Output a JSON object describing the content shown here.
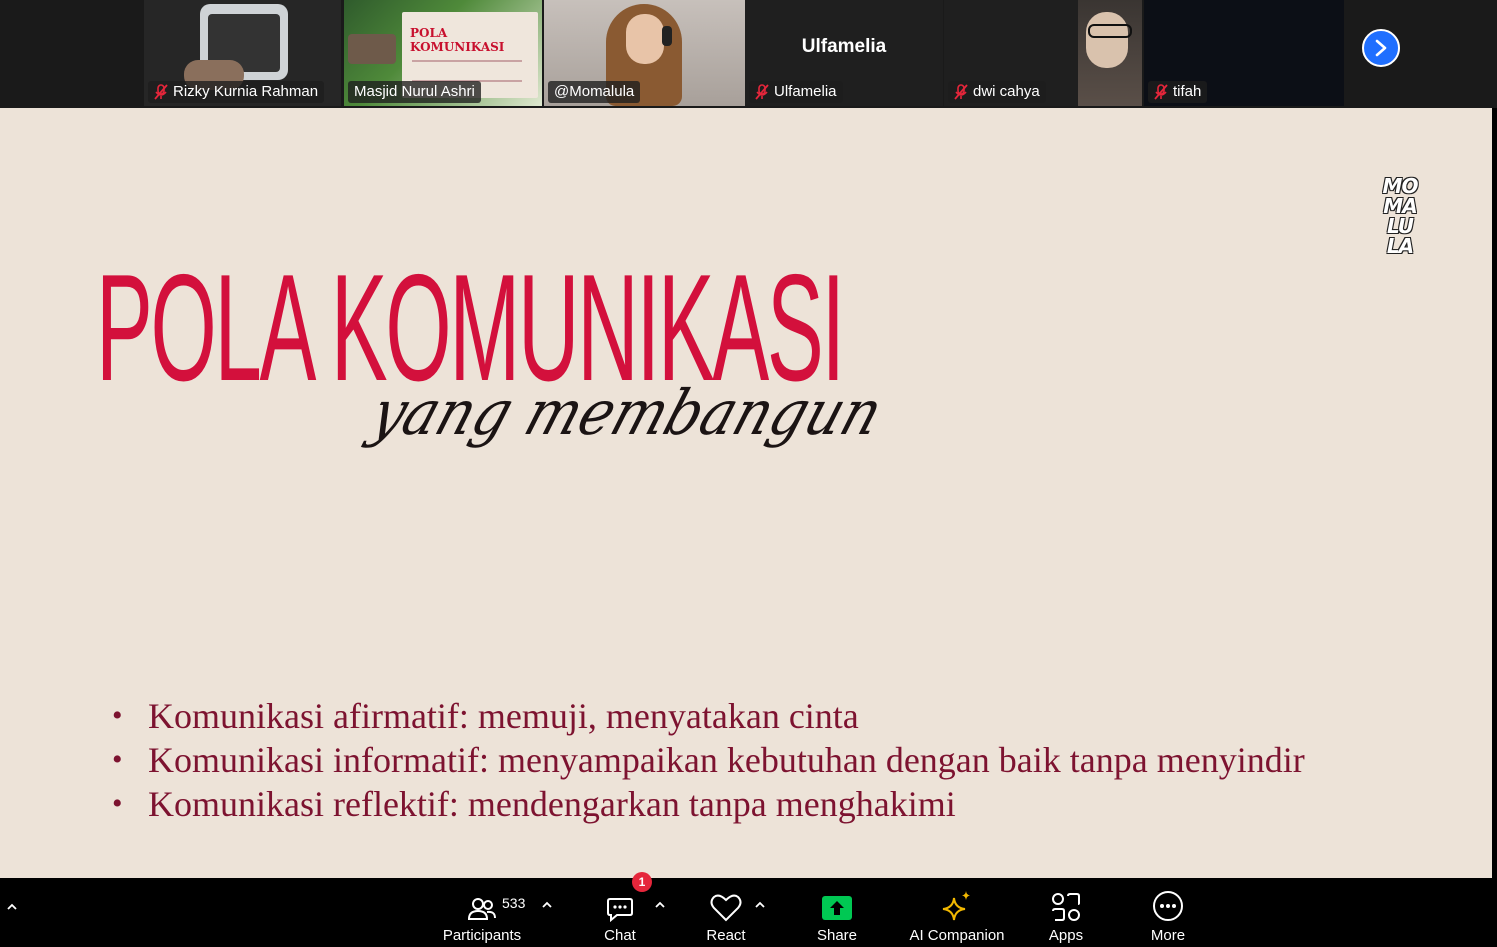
{
  "participants": [
    {
      "name": "Rizky Kurnia Rahman",
      "muted": true
    },
    {
      "name": "Masjid Nurul Ashri",
      "muted": false,
      "shared_slide_title": "POLA KOMUNIKASI"
    },
    {
      "name": "@Momalula",
      "muted": false,
      "active_speaker": true
    },
    {
      "name": "Ulfamelia",
      "muted": true,
      "display_name_large": "Ulfamelia"
    },
    {
      "name": "dwi cahya",
      "muted": true
    },
    {
      "name": "tifah",
      "muted": true
    }
  ],
  "slide": {
    "title": "POLA KOMUNIKASI",
    "subtitle": "yang membangun",
    "brand_lines": [
      "MO",
      "MA",
      "LU",
      "LA"
    ],
    "bullets": [
      "Komunikasi afirmatif: memuji, menyatakan cinta",
      "Komunikasi informatif: menyampaikan kebutuhan dengan baik tanpa menyindir",
      "Komunikasi reflektif: mendengarkan tanpa menghakimi"
    ]
  },
  "toolbar": {
    "participants": {
      "label": "Participants",
      "count": "533"
    },
    "chat": {
      "label": "Chat",
      "badge": "1"
    },
    "react": {
      "label": "React"
    },
    "share": {
      "label": "Share"
    },
    "ai": {
      "label": "AI Companion"
    },
    "apps": {
      "label": "Apps"
    },
    "more": {
      "label": "More"
    }
  },
  "colors": {
    "slide_background": "#ede3d8",
    "title_red": "#d3103c",
    "bullet_text": "#7d1330",
    "active_speaker_border": "#22d67a",
    "share_green": "#00c853",
    "next_button_blue": "#1f6fff",
    "badge_red": "#e5263b"
  }
}
